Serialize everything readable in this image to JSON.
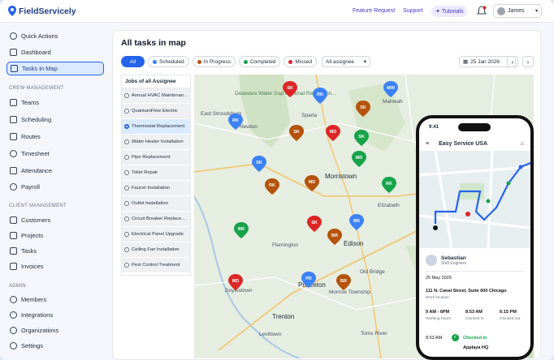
{
  "app": {
    "name": "FieldServicely"
  },
  "topbar": {
    "feature_request": "Feature Request",
    "support": "Support",
    "tutorials": "Tutorials",
    "user_name": "James"
  },
  "sidebar": {
    "top_items": [
      {
        "label": "Quick Actions",
        "icon": "bolt-icon"
      },
      {
        "label": "Dashboard",
        "icon": "dashboard-icon"
      },
      {
        "label": "Tasks in Map",
        "icon": "map-icon",
        "active": true
      }
    ],
    "crew_section": "CREW MANAGEMENT",
    "crew_items": [
      {
        "label": "Teams",
        "icon": "teams-icon"
      },
      {
        "label": "Scheduling",
        "icon": "calendar-icon"
      },
      {
        "label": "Routes",
        "icon": "route-icon"
      },
      {
        "label": "Timesheet",
        "icon": "clock-icon"
      },
      {
        "label": "Attendance",
        "icon": "attendance-icon"
      },
      {
        "label": "Payroll",
        "icon": "payroll-icon"
      }
    ],
    "client_section": "CLIENT MANAGEMENT",
    "client_items": [
      {
        "label": "Customers",
        "icon": "customers-icon"
      },
      {
        "label": "Projects",
        "icon": "projects-icon"
      },
      {
        "label": "Tasks",
        "icon": "tasks-icon"
      },
      {
        "label": "Invoices",
        "icon": "invoice-icon"
      }
    ],
    "admin_section": "ADMIN",
    "admin_items": [
      {
        "label": "Members",
        "icon": "members-icon"
      },
      {
        "label": "Integrations",
        "icon": "integrations-icon"
      },
      {
        "label": "Organizations",
        "icon": "organizations-icon"
      },
      {
        "label": "Settings",
        "icon": "gear-icon"
      }
    ]
  },
  "main": {
    "title": "All tasks in map",
    "filters": [
      {
        "label": "All",
        "color": "#2563eb"
      },
      {
        "label": "Scheduled",
        "color": "#3b82f6"
      },
      {
        "label": "In Progress",
        "color": "#b45309"
      },
      {
        "label": "Completed",
        "color": "#16a34a"
      },
      {
        "label": "Missed",
        "color": "#dc2626"
      }
    ],
    "assignee_select": "All assignee",
    "date": "25 Jan 2026",
    "jobs_header": "Jobs of all Assignee",
    "jobs": [
      "Annual HVAC Maintenan...",
      "QuantumFlow Electric",
      "Thermostat Replacement",
      "Water Heater Installation",
      "Pipe Replacement",
      "Toilet Repair",
      "Faucet Installation",
      "Outlet Installation",
      "Circuit Breaker Replace...",
      "Electrical Panel Upgrade",
      "Ceiling Fan Installation",
      "Pest Control Treatment"
    ],
    "selected_job_index": 2
  },
  "map": {
    "places": [
      "East Stroudsburg",
      "Delaware Water Gap National Recreation...",
      "Sparta",
      "Mahwah",
      "Newton",
      "Morristown",
      "Elizabeth",
      "Edison",
      "Old Bridge",
      "Flemington",
      "Princeton",
      "Doylestown",
      "Monroe Township",
      "Trenton",
      "Levittown",
      "Toms River"
    ],
    "pins": [
      {
        "code": "SK",
        "color": "#dc2626"
      },
      {
        "code": "RK",
        "color": "#3b82f6"
      },
      {
        "code": "MW",
        "color": "#3b82f6"
      },
      {
        "code": "SK",
        "color": "#b45309"
      },
      {
        "code": "RK",
        "color": "#3b82f6"
      },
      {
        "code": "SK",
        "color": "#b45309"
      },
      {
        "code": "SK",
        "color": "#16a34a"
      },
      {
        "code": "MD",
        "color": "#dc2626"
      },
      {
        "code": "MD",
        "color": "#16a34a"
      },
      {
        "code": "SK",
        "color": "#3b82f6"
      },
      {
        "code": "RK",
        "color": "#b45309"
      },
      {
        "code": "MD",
        "color": "#b45309"
      },
      {
        "code": "RK",
        "color": "#16a34a"
      },
      {
        "code": "SK",
        "color": "#dc2626"
      },
      {
        "code": "BR",
        "color": "#3b82f6"
      },
      {
        "code": "BR",
        "color": "#b45309"
      },
      {
        "code": "BR",
        "color": "#16a34a"
      },
      {
        "code": "MD",
        "color": "#dc2626"
      },
      {
        "code": "PD",
        "color": "#3b82f6"
      },
      {
        "code": "BR",
        "color": "#b45309"
      }
    ]
  },
  "phone": {
    "time": "9:41",
    "company": "Easy Service USA",
    "tech_name": "Sebastian",
    "tech_role": "Shift Engineer",
    "date": "25 May 2026",
    "address": "111 N. Canal Street, Suite 600 Chicago",
    "address_sub": "Work location",
    "hours": [
      {
        "value": "9 AM - 6PM",
        "label": "Working hours"
      },
      {
        "value": "8:53 AM",
        "label": "Clocked In"
      },
      {
        "value": "6:15 PM",
        "label": "Clocked out"
      }
    ],
    "checkin_time": "8:53 AM",
    "checkin_status": "Checked in",
    "checkin_place": "Applaya HQ"
  }
}
